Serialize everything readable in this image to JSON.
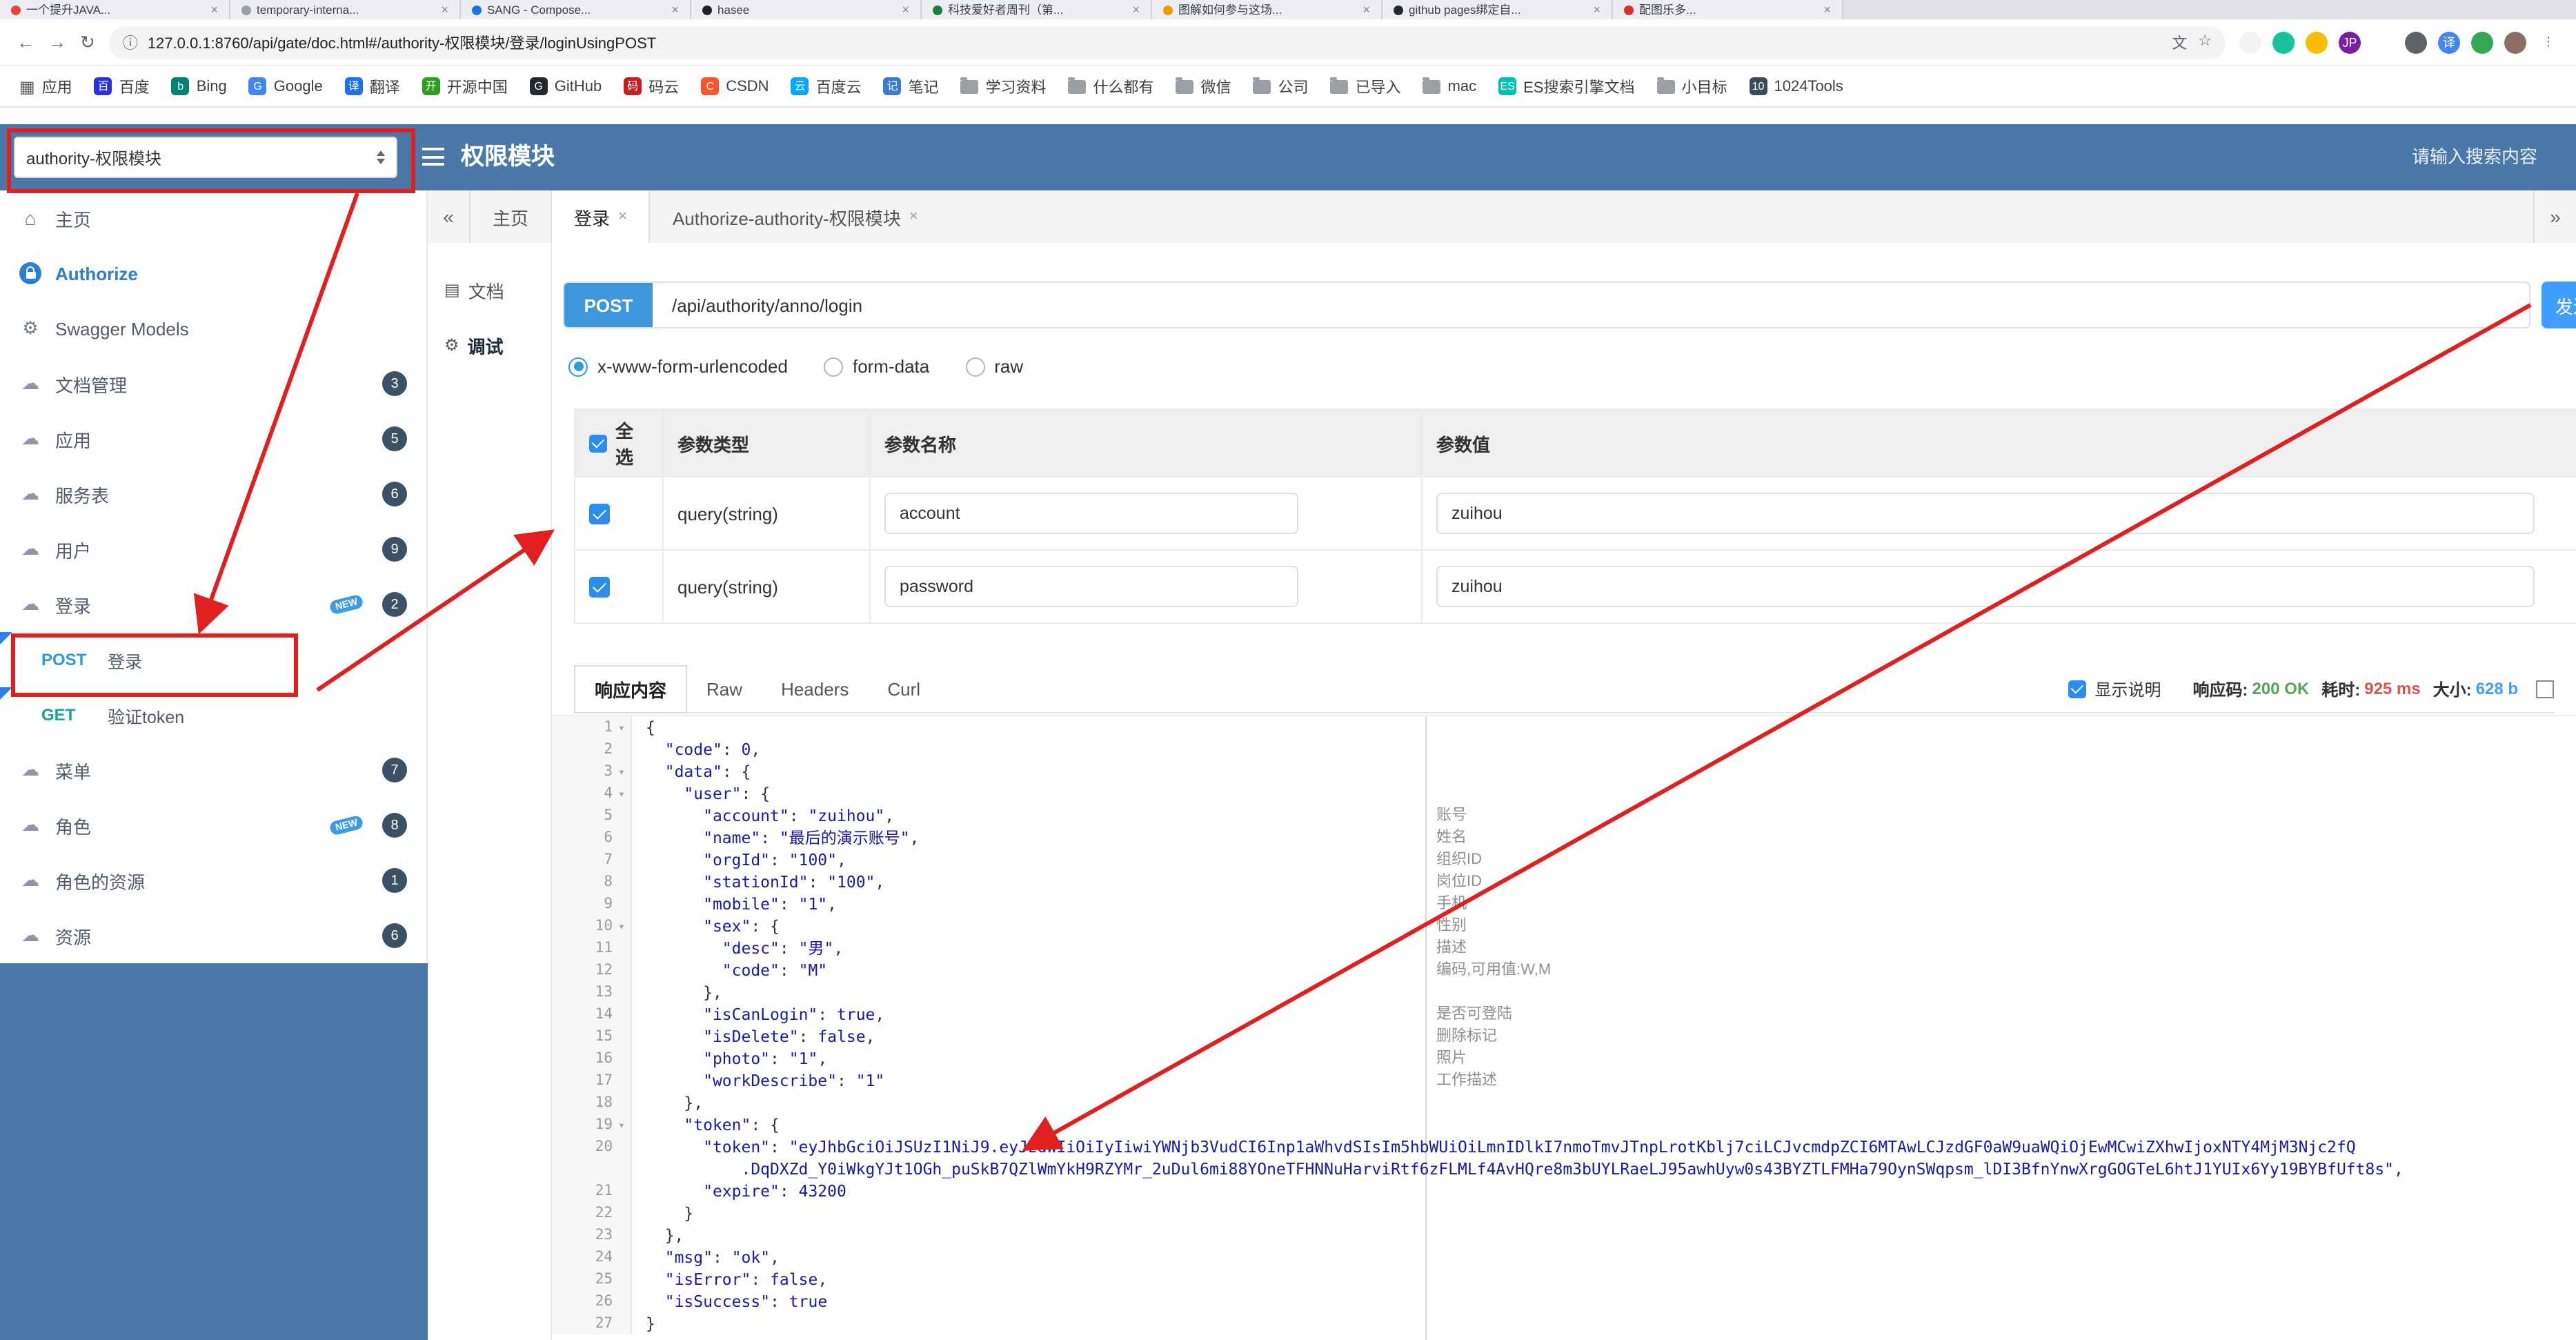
{
  "browser": {
    "tabs": [
      {
        "title": "一个提升JAVA...",
        "color": "#e8453c"
      },
      {
        "title": "temporary-interna...",
        "color": "#9aa0a6"
      },
      {
        "title": "SANG - Compose...",
        "color": "#1a73e8"
      },
      {
        "title": "hasee",
        "color": "#202124"
      },
      {
        "title": "科技爱好者周刊（第...",
        "color": "#188038"
      },
      {
        "title": "图解如何参与这场...",
        "color": "#f29900"
      },
      {
        "title": "github pages绑定自...",
        "color": "#24292e"
      },
      {
        "title": "配图乐多...",
        "color": "#d93025"
      }
    ],
    "nav_icons": {
      "back": "←",
      "forward": "→",
      "reload": "↻"
    },
    "url_info_icon": "ⓘ",
    "url": "127.0.0.1:8760/api/gate/doc.html#/authority-权限模块/登录/loginUsingPOST",
    "url_field_icons": [
      {
        "name": "translate-icon",
        "glyph": "文"
      },
      {
        "name": "bookmark-star-icon",
        "glyph": "☆"
      }
    ],
    "toolbar_icons": [
      {
        "name": "extension-icon-1",
        "color": "#f1f3f4"
      },
      {
        "name": "grammarly-icon",
        "color": "#15c39a"
      },
      {
        "name": "google-keep-icon",
        "color": "#fbbc04"
      },
      {
        "name": "json-formatter-icon",
        "color": "#7b1fa2",
        "glyph": "JP",
        "fg": "#ffffff"
      },
      {
        "name": "extension-icon-2",
        "color": "#ffffff"
      },
      {
        "name": "adblock-shield-icon",
        "color": "#5f6368"
      },
      {
        "name": "translate-extension-icon",
        "color": "#4285f4",
        "glyph": "译",
        "fg": "#ffffff"
      },
      {
        "name": "pinwheel-extension-icon",
        "color": "#34a853"
      },
      {
        "name": "profile-avatar",
        "color": "#8d6e63"
      },
      {
        "name": "browser-menu-icon",
        "color": "",
        "glyph": "⋮"
      }
    ],
    "bookmarks": [
      {
        "key": "apps",
        "label": "应用",
        "type": "grid"
      },
      {
        "key": "baidu",
        "label": "百度",
        "type": "site",
        "color": "#2932e1",
        "glyph": "百"
      },
      {
        "key": "bing",
        "label": "Bing",
        "type": "site",
        "color": "#008373",
        "glyph": "b"
      },
      {
        "key": "google",
        "label": "Google",
        "type": "site",
        "color": "#4285f4",
        "glyph": "G"
      },
      {
        "key": "translate",
        "label": "翻译",
        "type": "site",
        "color": "#1a73e8",
        "glyph": "译"
      },
      {
        "key": "oschina",
        "label": "开源中国",
        "type": "site",
        "color": "#2ca01c",
        "glyph": "开"
      },
      {
        "key": "github",
        "label": "GitHub",
        "type": "site",
        "color": "#24292e",
        "glyph": "G"
      },
      {
        "key": "gitee",
        "label": "码云",
        "type": "site",
        "color": "#c71d23",
        "glyph": "码"
      },
      {
        "key": "csdn",
        "label": "CSDN",
        "type": "site",
        "color": "#fc5531",
        "glyph": "C"
      },
      {
        "key": "baiduyun",
        "label": "百度云",
        "type": "site",
        "color": "#06a7ff",
        "glyph": "云"
      },
      {
        "key": "notes",
        "label": "笔记",
        "type": "site",
        "color": "#3a7bd5",
        "glyph": "记"
      },
      {
        "key": "study",
        "label": "学习资料",
        "type": "folder"
      },
      {
        "key": "everything",
        "label": "什么都有",
        "type": "folder"
      },
      {
        "key": "wechat",
        "label": "微信",
        "type": "folder"
      },
      {
        "key": "company",
        "label": "公司",
        "type": "folder"
      },
      {
        "key": "imported",
        "label": "已导入",
        "type": "folder"
      },
      {
        "key": "mac",
        "label": "mac",
        "type": "folder"
      },
      {
        "key": "es-docs",
        "label": "ES搜索引擎文档",
        "type": "site",
        "color": "#00bfb3",
        "glyph": "ES"
      },
      {
        "key": "goal",
        "label": "小目标",
        "type": "folder"
      },
      {
        "key": "tools1024",
        "label": "1024Tools",
        "type": "site",
        "color": "#3b4a5a",
        "glyph": "10"
      }
    ]
  },
  "header": {
    "group_select": "authority-权限模块",
    "title": "权限模块",
    "search_placeholder": "请输入搜索内容"
  },
  "sidebar": {
    "new_label": "NEW",
    "items": [
      {
        "key": "home",
        "label": "主页",
        "icon": "home"
      },
      {
        "key": "authorize",
        "label": "Authorize",
        "icon": "lock"
      },
      {
        "key": "swagger-models",
        "label": "Swagger Models",
        "icon": "gear"
      },
      {
        "key": "doc-manage",
        "label": "文档管理",
        "icon": "cloud",
        "badge": "3"
      },
      {
        "key": "app",
        "label": "应用",
        "icon": "cloud",
        "badge": "5"
      },
      {
        "key": "service",
        "label": "服务表",
        "icon": "cloud",
        "badge": "6"
      },
      {
        "key": "user",
        "label": "用户",
        "icon": "cloud",
        "badge": "9"
      },
      {
        "key": "login",
        "label": "登录",
        "icon": "cloud",
        "badge": "2",
        "is_new": true
      },
      {
        "key": "menu",
        "label": "菜单",
        "icon": "cloud",
        "badge": "7"
      },
      {
        "key": "role",
        "label": "角色",
        "icon": "cloud",
        "badge": "8",
        "is_new": true
      },
      {
        "key": "role-resource",
        "label": "角色的资源",
        "icon": "cloud",
        "badge": "1"
      },
      {
        "key": "resource",
        "label": "资源",
        "icon": "cloud",
        "badge": "6"
      }
    ],
    "login_children": [
      {
        "key": "post-login",
        "method": "POST",
        "label": "登录",
        "highlight": true
      },
      {
        "key": "get-verify-token",
        "method": "GET",
        "label": "验证token"
      }
    ]
  },
  "tabs": {
    "collapse_label": "«",
    "expand_label": "»",
    "items": [
      {
        "key": "home",
        "label": "主页",
        "closable": false
      },
      {
        "key": "login",
        "label": "登录",
        "closable": true,
        "active": true
      },
      {
        "key": "authorize",
        "label": "Authorize-authority-权限模块",
        "closable": true
      }
    ]
  },
  "docnav": {
    "doc": "文档",
    "debug": "调试"
  },
  "request": {
    "method": "POST",
    "path": "/api/authority/anno/login",
    "send_label": "发送",
    "content_types": [
      {
        "key": "x-www-form-urlencoded",
        "label": "x-www-form-urlencoded",
        "selected": true
      },
      {
        "key": "form-data",
        "label": "form-data",
        "selected": false
      },
      {
        "key": "raw",
        "label": "raw",
        "selected": false
      }
    ]
  },
  "params": {
    "headers": {
      "select_all": "全选",
      "type": "参数类型",
      "name": "参数名称",
      "value": "参数值"
    },
    "rows": [
      {
        "type": "query(string)",
        "name": "account",
        "value": "zuihou",
        "checked": true
      },
      {
        "type": "query(string)",
        "name": "password",
        "value": "zuihou",
        "checked": true
      }
    ]
  },
  "response": {
    "tabs": [
      {
        "key": "body",
        "label": "响应内容",
        "active": true
      },
      {
        "key": "raw",
        "label": "Raw",
        "active": false
      },
      {
        "key": "headers",
        "label": "Headers",
        "active": false
      },
      {
        "key": "curl",
        "label": "Curl",
        "active": false
      }
    ],
    "show_desc_label": "显示说明",
    "meta": {
      "code_label": "响应码:",
      "code": "200 OK",
      "time_label": "耗时:",
      "time": "925 ms",
      "size_label": "大小:",
      "size": "628 b"
    }
  },
  "code": {
    "lines": [
      {
        "n": "1",
        "fold": true,
        "text": "{"
      },
      {
        "n": "2",
        "text": "  \"code\": 0,"
      },
      {
        "n": "3",
        "fold": true,
        "text": "  \"data\": {"
      },
      {
        "n": "4",
        "fold": true,
        "text": "    \"user\": {"
      },
      {
        "n": "5",
        "text": "      \"account\": \"zuihou\",",
        "ann": "账号"
      },
      {
        "n": "6",
        "text": "      \"name\": \"最后的演示账号\",",
        "ann": "姓名"
      },
      {
        "n": "7",
        "text": "      \"orgId\": \"100\",",
        "ann": "组织ID"
      },
      {
        "n": "8",
        "text": "      \"stationId\": \"100\",",
        "ann": "岗位ID"
      },
      {
        "n": "9",
        "text": "      \"mobile\": \"1\",",
        "ann": "手机"
      },
      {
        "n": "10",
        "fold": true,
        "text": "      \"sex\": {",
        "ann": "性别"
      },
      {
        "n": "11",
        "text": "        \"desc\": \"男\",",
        "ann": "描述"
      },
      {
        "n": "12",
        "text": "        \"code\": \"M\"",
        "ann": "编码,可用值:W,M"
      },
      {
        "n": "13",
        "text": "      },"
      },
      {
        "n": "14",
        "text": "      \"isCanLogin\": true,",
        "ann": "是否可登陆"
      },
      {
        "n": "15",
        "text": "      \"isDelete\": false,",
        "ann": "删除标记"
      },
      {
        "n": "16",
        "text": "      \"photo\": \"1\",",
        "ann": "照片"
      },
      {
        "n": "17",
        "text": "      \"workDescribe\": \"1\"",
        "ann": "工作描述"
      },
      {
        "n": "18",
        "text": "    },"
      },
      {
        "n": "19",
        "fold": true,
        "text": "    \"token\": {"
      },
      {
        "n": "20",
        "text": "      \"token\": \"eyJhbGciOiJSUzI1NiJ9.eyJzdWIiOiIyIiwiYWNjb3VudCI6Inp1aWhvdSIsIm5hbWUiOiLmnIDlkI7nmoTmvJTnpLrotKblj7ciLCJvcmdpZCI6MTAwLCJzdGF0aW9uaWQiOjEwMCwiZXhwIjoxNTY4MjM3Njc2fQ"
      },
      {
        "n": "",
        "cont": true,
        "text": "          .DqDXZd_Y0iWkgYJt1OGh_puSkB7QZlWmYkH9RZYMr_2uDul6mi88YOneTFHNNuHarviRtf6zFLMLf4AvHQre8m3bUYLRaeLJ95awhUyw0s43BYZTLFMHa79OynSWqpsm_lDI3BfnYnwXrgGOGTeL6htJ1YUIx6Yy19BYBfUft8s\","
      },
      {
        "n": "21",
        "text": "      \"expire\": 43200"
      },
      {
        "n": "22",
        "text": "    }"
      },
      {
        "n": "23",
        "text": "  },"
      },
      {
        "n": "24",
        "text": "  \"msg\": \"ok\","
      },
      {
        "n": "25",
        "text": "  \"isError\": false,"
      },
      {
        "n": "26",
        "text": "  \"isSuccess\": true"
      },
      {
        "n": "27",
        "text": "}"
      }
    ]
  }
}
